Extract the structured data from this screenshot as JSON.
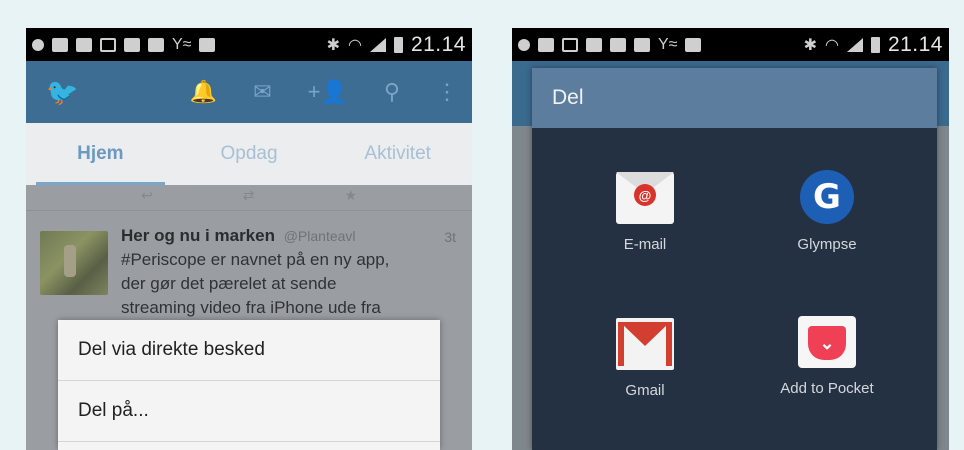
{
  "left_screen": {
    "status_time": "21.14",
    "status_text": "Y≈",
    "tabs": [
      {
        "label": "Hjem"
      },
      {
        "label": "Opdag"
      },
      {
        "label": "Aktivitet"
      }
    ],
    "tweet": {
      "name": "Her og nu i marken",
      "handle": "@Planteavl",
      "time": "3t",
      "text_lines": [
        "#Periscope er navnet på en ny app,",
        "der gør det pærelet at sende",
        "streaming video fra iPhone ude fra"
      ]
    },
    "menu": [
      {
        "label": "Del via direkte besked"
      },
      {
        "label": "Del på..."
      }
    ]
  },
  "right_screen": {
    "status_time": "21.14",
    "status_text": "Y≈",
    "dialog_title": "Del",
    "share_targets": [
      {
        "label": "E-mail",
        "icon": "email-icon"
      },
      {
        "label": "Glympse",
        "icon": "glympse-icon"
      },
      {
        "label": "Gmail",
        "icon": "gmail-icon"
      },
      {
        "label": "Add to Pocket",
        "icon": "pocket-icon"
      }
    ]
  },
  "colors": {
    "twitter_appbar": "#3e6d93",
    "dialog_bg": "#243142",
    "dialog_title_bg": "#5c7d9d"
  }
}
